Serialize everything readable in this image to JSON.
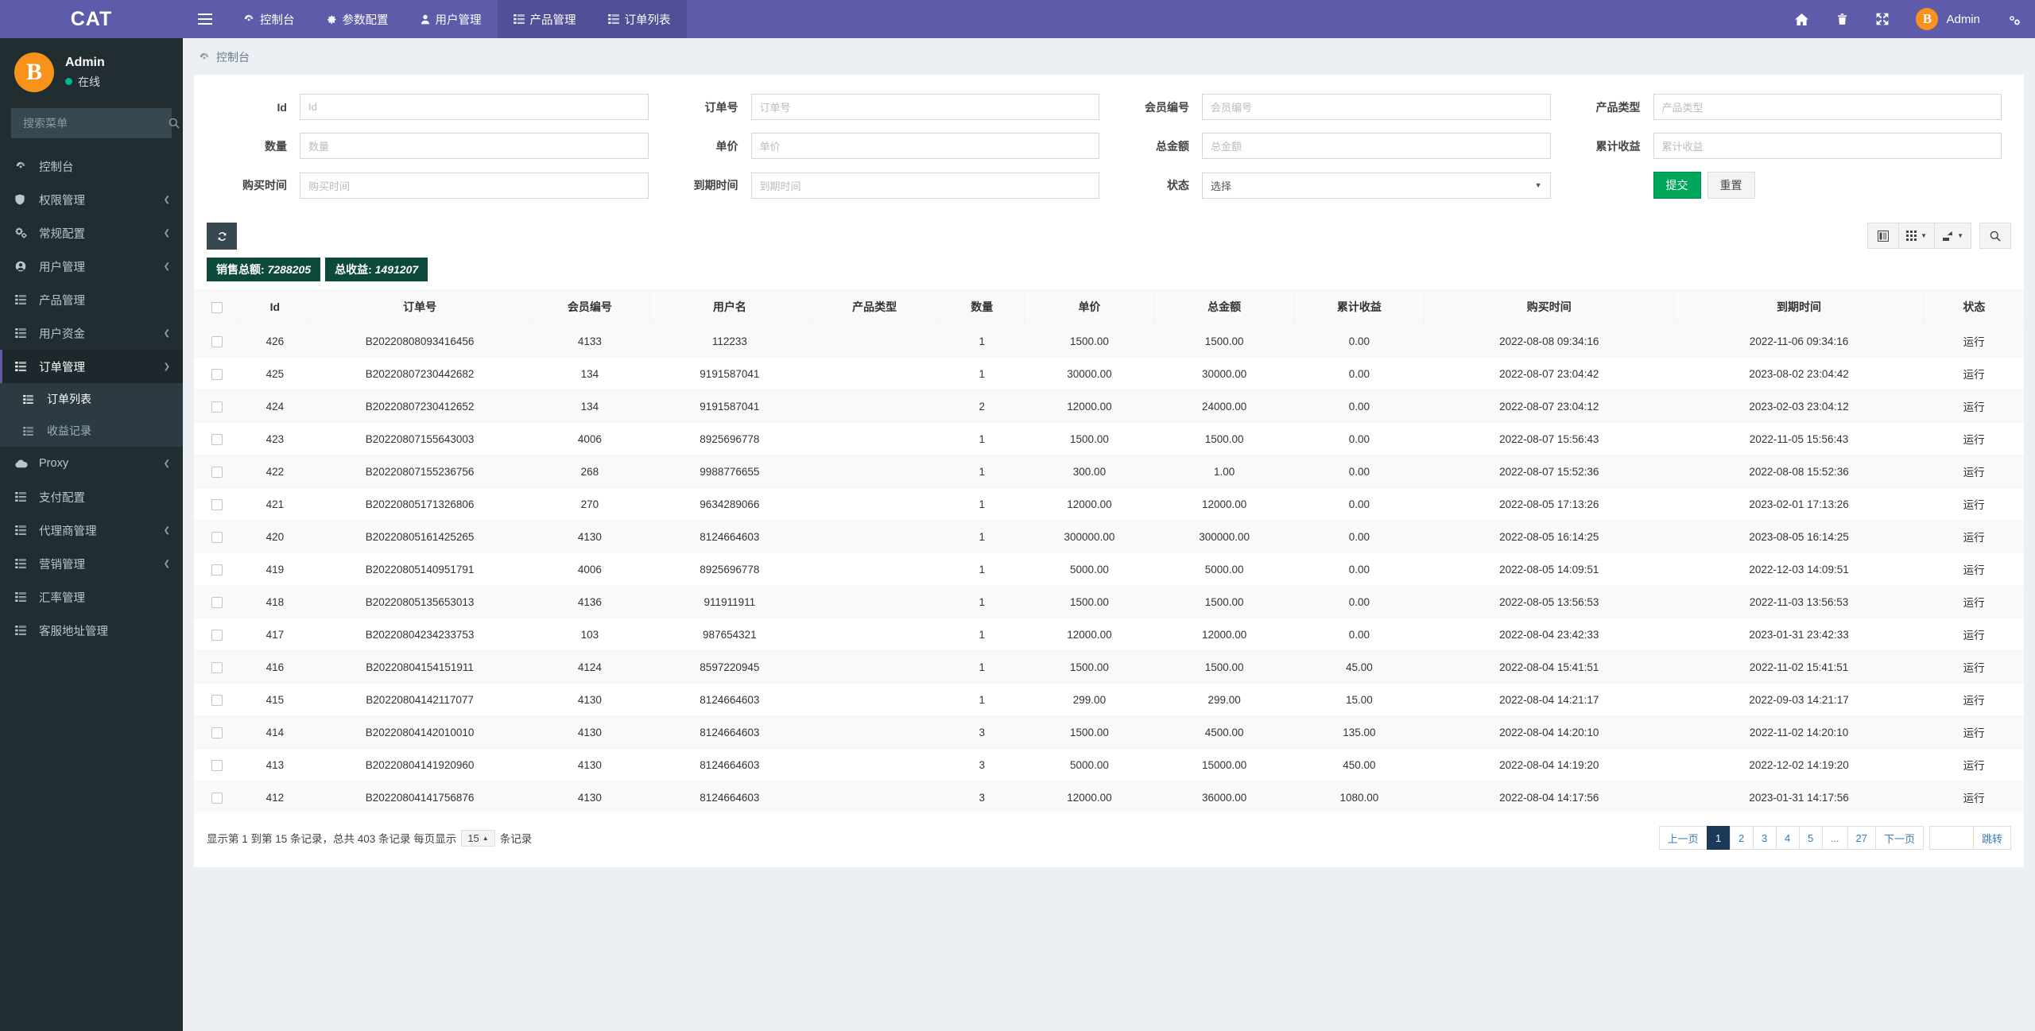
{
  "brand": {
    "title": "CAT"
  },
  "navbar": {
    "toggle_icon": "hamburger-icon",
    "items": [
      {
        "label": "控制台",
        "icon": "dashboard-icon",
        "active": false
      },
      {
        "label": "参数配置",
        "icon": "gear-icon",
        "active": false
      },
      {
        "label": "用户管理",
        "icon": "user-icon",
        "active": false
      },
      {
        "label": "产品管理",
        "icon": "list-icon",
        "active": true
      },
      {
        "label": "订单列表",
        "icon": "list-icon",
        "active": false
      }
    ],
    "right_icons": [
      "home-icon",
      "trash-icon",
      "fullscreen-icon"
    ],
    "user": {
      "name": "Admin",
      "avatar_glyph": "B"
    },
    "settings_icon": "gears-icon"
  },
  "sidebar": {
    "user": {
      "name": "Admin",
      "status": "在线",
      "avatar_glyph": "B"
    },
    "search": {
      "placeholder": "搜索菜单",
      "value": "",
      "icon": "search-icon"
    },
    "items": [
      {
        "label": "控制台",
        "icon": "dashboard-icon",
        "caret": false
      },
      {
        "label": "权限管理",
        "icon": "shield-icon",
        "caret": true
      },
      {
        "label": "常规配置",
        "icon": "gears-icon",
        "caret": true
      },
      {
        "label": "用户管理",
        "icon": "user-circle-icon",
        "caret": true
      },
      {
        "label": "产品管理",
        "icon": "list-icon",
        "caret": false
      },
      {
        "label": "用户资金",
        "icon": "list-icon",
        "caret": true
      },
      {
        "label": "订单管理",
        "icon": "list-icon",
        "caret": true,
        "open": true,
        "children": [
          {
            "label": "订单列表",
            "icon": "list-icon",
            "active": true
          },
          {
            "label": "收益记录",
            "icon": "list-icon",
            "active": false
          }
        ]
      },
      {
        "label": "Proxy",
        "icon": "cloud-icon",
        "caret": true
      },
      {
        "label": "支付配置",
        "icon": "list-icon",
        "caret": false
      },
      {
        "label": "代理商管理",
        "icon": "list-icon",
        "caret": true
      },
      {
        "label": "营销管理",
        "icon": "list-icon",
        "caret": true
      },
      {
        "label": "汇率管理",
        "icon": "list-icon",
        "caret": false
      },
      {
        "label": "客服地址管理",
        "icon": "list-icon",
        "caret": false
      }
    ]
  },
  "breadcrumb": {
    "icon": "dashboard-icon",
    "text": "控制台"
  },
  "search_form": {
    "fields": [
      {
        "label": "Id",
        "placeholder": "Id",
        "value": "",
        "type": "text"
      },
      {
        "label": "订单号",
        "placeholder": "订单号",
        "value": "",
        "type": "text"
      },
      {
        "label": "会员编号",
        "placeholder": "会员编号",
        "value": "",
        "type": "text"
      },
      {
        "label": "产品类型",
        "placeholder": "产品类型",
        "value": "",
        "type": "text"
      },
      {
        "label": "数量",
        "placeholder": "数量",
        "value": "",
        "type": "text"
      },
      {
        "label": "单价",
        "placeholder": "单价",
        "value": "",
        "type": "text"
      },
      {
        "label": "总金额",
        "placeholder": "总金额",
        "value": "",
        "type": "text"
      },
      {
        "label": "累计收益",
        "placeholder": "累计收益",
        "value": "",
        "type": "text"
      },
      {
        "label": "购买时间",
        "placeholder": "购买时间",
        "value": "",
        "type": "text"
      },
      {
        "label": "到期时间",
        "placeholder": "到期时间",
        "value": "",
        "type": "text"
      },
      {
        "label": "状态",
        "placeholder": "选择",
        "value": "选择",
        "type": "select"
      }
    ],
    "submit_label": "提交",
    "reset_label": "重置"
  },
  "toolbar": {
    "refresh_icon": "refresh-icon",
    "stats": [
      {
        "label": "销售总额:",
        "value": "7288205"
      },
      {
        "label": "总收益:",
        "value": "1491207"
      }
    ],
    "tools": [
      {
        "icon": "columns-icon",
        "caret": false
      },
      {
        "icon": "grid-icon",
        "caret": true
      },
      {
        "icon": "export-icon",
        "caret": true
      },
      {
        "icon": "search-icon",
        "caret": false
      }
    ]
  },
  "table": {
    "columns": [
      "",
      "Id",
      "订单号",
      "会员编号",
      "用户名",
      "产品类型",
      "数量",
      "单价",
      "总金额",
      "累计收益",
      "购买时间",
      "到期时间",
      "状态"
    ],
    "rows": [
      {
        "id": "426",
        "order_no": "B20220808093416456",
        "member": "4133",
        "username": "112233",
        "ptype": "",
        "qty": "1",
        "price": "1500.00",
        "total": "1500.00",
        "profit": "0.00",
        "buy_time": "2022-08-08 09:34:16",
        "expire_time": "2022-11-06 09:34:16",
        "status": "运行"
      },
      {
        "id": "425",
        "order_no": "B20220807230442682",
        "member": "134",
        "username": "9191587041",
        "ptype": "",
        "qty": "1",
        "price": "30000.00",
        "total": "30000.00",
        "profit": "0.00",
        "buy_time": "2022-08-07 23:04:42",
        "expire_time": "2023-08-02 23:04:42",
        "status": "运行"
      },
      {
        "id": "424",
        "order_no": "B20220807230412652",
        "member": "134",
        "username": "9191587041",
        "ptype": "",
        "qty": "2",
        "price": "12000.00",
        "total": "24000.00",
        "profit": "0.00",
        "buy_time": "2022-08-07 23:04:12",
        "expire_time": "2023-02-03 23:04:12",
        "status": "运行"
      },
      {
        "id": "423",
        "order_no": "B20220807155643003",
        "member": "4006",
        "username": "8925696778",
        "ptype": "",
        "qty": "1",
        "price": "1500.00",
        "total": "1500.00",
        "profit": "0.00",
        "buy_time": "2022-08-07 15:56:43",
        "expire_time": "2022-11-05 15:56:43",
        "status": "运行"
      },
      {
        "id": "422",
        "order_no": "B20220807155236756",
        "member": "268",
        "username": "9988776655",
        "ptype": "",
        "qty": "1",
        "price": "300.00",
        "total": "1.00",
        "profit": "0.00",
        "buy_time": "2022-08-07 15:52:36",
        "expire_time": "2022-08-08 15:52:36",
        "status": "运行"
      },
      {
        "id": "421",
        "order_no": "B20220805171326806",
        "member": "270",
        "username": "9634289066",
        "ptype": "",
        "qty": "1",
        "price": "12000.00",
        "total": "12000.00",
        "profit": "0.00",
        "buy_time": "2022-08-05 17:13:26",
        "expire_time": "2023-02-01 17:13:26",
        "status": "运行"
      },
      {
        "id": "420",
        "order_no": "B20220805161425265",
        "member": "4130",
        "username": "8124664603",
        "ptype": "",
        "qty": "1",
        "price": "300000.00",
        "total": "300000.00",
        "profit": "0.00",
        "buy_time": "2022-08-05 16:14:25",
        "expire_time": "2023-08-05 16:14:25",
        "status": "运行"
      },
      {
        "id": "419",
        "order_no": "B20220805140951791",
        "member": "4006",
        "username": "8925696778",
        "ptype": "",
        "qty": "1",
        "price": "5000.00",
        "total": "5000.00",
        "profit": "0.00",
        "buy_time": "2022-08-05 14:09:51",
        "expire_time": "2022-12-03 14:09:51",
        "status": "运行"
      },
      {
        "id": "418",
        "order_no": "B20220805135653013",
        "member": "4136",
        "username": "911911911",
        "ptype": "",
        "qty": "1",
        "price": "1500.00",
        "total": "1500.00",
        "profit": "0.00",
        "buy_time": "2022-08-05 13:56:53",
        "expire_time": "2022-11-03 13:56:53",
        "status": "运行"
      },
      {
        "id": "417",
        "order_no": "B20220804234233753",
        "member": "103",
        "username": "987654321",
        "ptype": "",
        "qty": "1",
        "price": "12000.00",
        "total": "12000.00",
        "profit": "0.00",
        "buy_time": "2022-08-04 23:42:33",
        "expire_time": "2023-01-31 23:42:33",
        "status": "运行"
      },
      {
        "id": "416",
        "order_no": "B20220804154151911",
        "member": "4124",
        "username": "8597220945",
        "ptype": "",
        "qty": "1",
        "price": "1500.00",
        "total": "1500.00",
        "profit": "45.00",
        "buy_time": "2022-08-04 15:41:51",
        "expire_time": "2022-11-02 15:41:51",
        "status": "运行"
      },
      {
        "id": "415",
        "order_no": "B20220804142117077",
        "member": "4130",
        "username": "8124664603",
        "ptype": "",
        "qty": "1",
        "price": "299.00",
        "total": "299.00",
        "profit": "15.00",
        "buy_time": "2022-08-04 14:21:17",
        "expire_time": "2022-09-03 14:21:17",
        "status": "运行"
      },
      {
        "id": "414",
        "order_no": "B20220804142010010",
        "member": "4130",
        "username": "8124664603",
        "ptype": "",
        "qty": "3",
        "price": "1500.00",
        "total": "4500.00",
        "profit": "135.00",
        "buy_time": "2022-08-04 14:20:10",
        "expire_time": "2022-11-02 14:20:10",
        "status": "运行"
      },
      {
        "id": "413",
        "order_no": "B20220804141920960",
        "member": "4130",
        "username": "8124664603",
        "ptype": "",
        "qty": "3",
        "price": "5000.00",
        "total": "15000.00",
        "profit": "450.00",
        "buy_time": "2022-08-04 14:19:20",
        "expire_time": "2022-12-02 14:19:20",
        "status": "运行"
      },
      {
        "id": "412",
        "order_no": "B20220804141756876",
        "member": "4130",
        "username": "8124664603",
        "ptype": "",
        "qty": "3",
        "price": "12000.00",
        "total": "36000.00",
        "profit": "1080.00",
        "buy_time": "2022-08-04 14:17:56",
        "expire_time": "2023-01-31 14:17:56",
        "status": "运行"
      }
    ]
  },
  "footer": {
    "info_prefix": "显示第 1 到第 15 条记录，总共 403 条记录 每页显示",
    "page_size": "15",
    "info_suffix": "条记录",
    "pager": {
      "prev": "上一页",
      "pages": [
        "1",
        "2",
        "3",
        "4",
        "5",
        "...",
        "27"
      ],
      "active": "1",
      "next": "下一页",
      "jump_value": "",
      "jump_label": "跳转"
    }
  },
  "colors": {
    "navbar": "#5d5baa",
    "sidebar": "#222d32",
    "accent_green": "#00a65a",
    "badge_green": "#0d4a3d",
    "btc_orange": "#f7931a",
    "page_active": "#1b3a57"
  }
}
